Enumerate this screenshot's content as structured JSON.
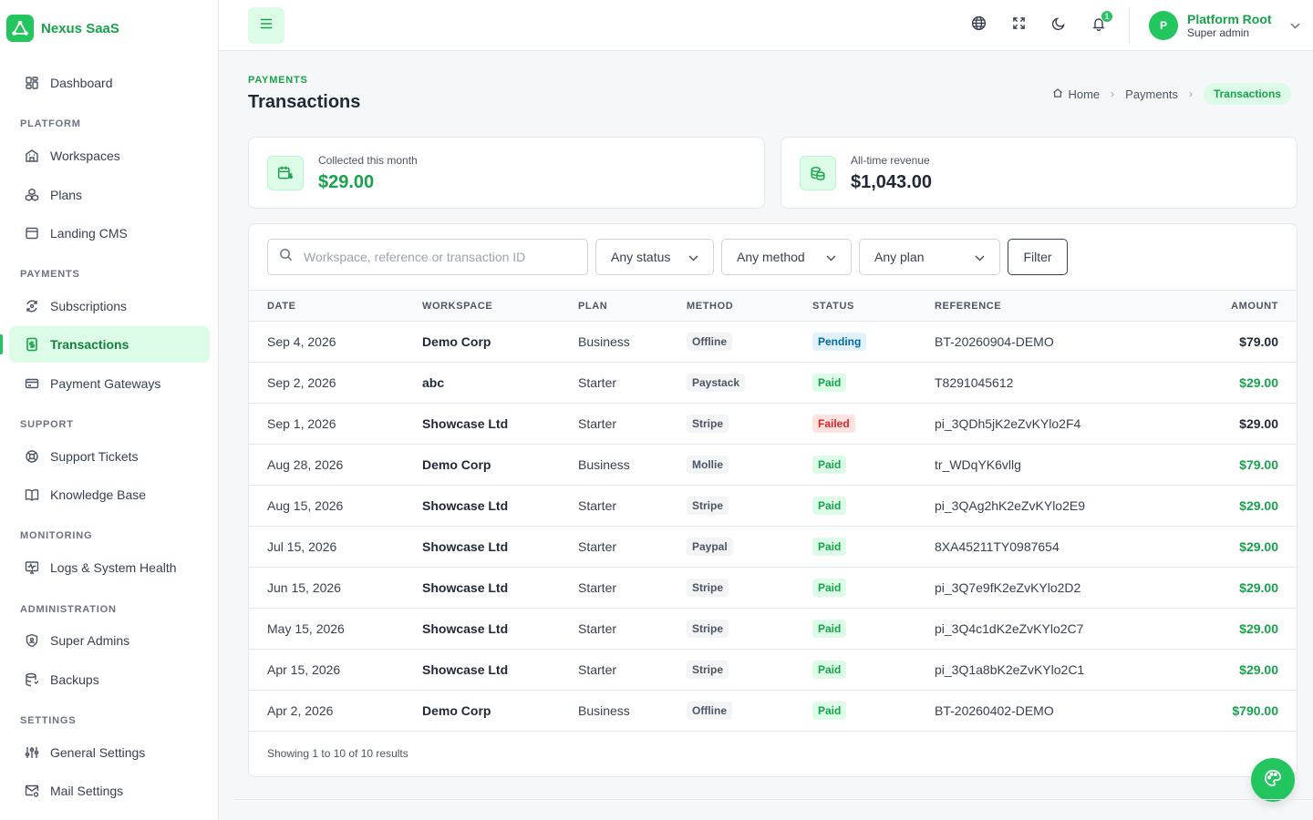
{
  "brand": {
    "name": "Nexus SaaS"
  },
  "sidebar": {
    "dashboard": "Dashboard",
    "sections": {
      "platform": "PLATFORM",
      "payments": "PAYMENTS",
      "support": "SUPPORT",
      "monitoring": "MONITORING",
      "administration": "ADMINISTRATION",
      "settings": "SETTINGS"
    },
    "items": {
      "workspaces": "Workspaces",
      "plans": "Plans",
      "landing_cms": "Landing CMS",
      "subscriptions": "Subscriptions",
      "transactions": "Transactions",
      "payment_gateways": "Payment Gateways",
      "support_tickets": "Support Tickets",
      "knowledge_base": "Knowledge Base",
      "logs": "Logs & System Health",
      "super_admins": "Super Admins",
      "backups": "Backups",
      "general_settings": "General Settings",
      "mail_settings": "Mail Settings"
    },
    "active": "transactions"
  },
  "topbar": {
    "notifications_count": "1",
    "user": {
      "initial": "P",
      "name": "Platform Root",
      "role": "Super admin"
    }
  },
  "page": {
    "kicker": "PAYMENTS",
    "title": "Transactions",
    "breadcrumb": {
      "home": "Home",
      "section": "Payments",
      "current": "Transactions"
    }
  },
  "stats": {
    "collected": {
      "label": "Collected this month",
      "value": "$29.00",
      "color": "#16a34a"
    },
    "revenue": {
      "label": "All-time revenue",
      "value": "$1,043.00",
      "color": "#1f2937"
    }
  },
  "filters": {
    "search_placeholder": "Workspace, reference or transaction ID",
    "status": "Any status",
    "method": "Any method",
    "plan": "Any plan",
    "filter_button": "Filter"
  },
  "table": {
    "headers": {
      "date": "DATE",
      "workspace": "WORKSPACE",
      "plan": "PLAN",
      "method": "METHOD",
      "status": "STATUS",
      "reference": "REFERENCE",
      "amount": "AMOUNT"
    },
    "rows": [
      {
        "date": "Sep 4, 2026",
        "workspace": "Demo Corp",
        "plan": "Business",
        "method": "Offline",
        "status": "Pending",
        "status_kind": "pending",
        "reference": "BT-20260904-DEMO",
        "amount": "$79.00"
      },
      {
        "date": "Sep 2, 2026",
        "workspace": "abc",
        "plan": "Starter",
        "method": "Paystack",
        "status": "Paid",
        "status_kind": "paid",
        "reference": "T8291045612",
        "amount": "$29.00"
      },
      {
        "date": "Sep 1, 2026",
        "workspace": "Showcase Ltd",
        "plan": "Starter",
        "method": "Stripe",
        "status": "Failed",
        "status_kind": "failed",
        "reference": "pi_3QDh5jK2eZvKYlo2F4",
        "amount": "$29.00"
      },
      {
        "date": "Aug 28, 2026",
        "workspace": "Demo Corp",
        "plan": "Business",
        "method": "Mollie",
        "status": "Paid",
        "status_kind": "paid",
        "reference": "tr_WDqYK6vllg",
        "amount": "$79.00"
      },
      {
        "date": "Aug 15, 2026",
        "workspace": "Showcase Ltd",
        "plan": "Starter",
        "method": "Stripe",
        "status": "Paid",
        "status_kind": "paid",
        "reference": "pi_3QAg2hK2eZvKYlo2E9",
        "amount": "$29.00"
      },
      {
        "date": "Jul 15, 2026",
        "workspace": "Showcase Ltd",
        "plan": "Starter",
        "method": "Paypal",
        "status": "Paid",
        "status_kind": "paid",
        "reference": "8XA45211TY0987654",
        "amount": "$29.00"
      },
      {
        "date": "Jun 15, 2026",
        "workspace": "Showcase Ltd",
        "plan": "Starter",
        "method": "Stripe",
        "status": "Paid",
        "status_kind": "paid",
        "reference": "pi_3Q7e9fK2eZvKYlo2D2",
        "amount": "$29.00"
      },
      {
        "date": "May 15, 2026",
        "workspace": "Showcase Ltd",
        "plan": "Starter",
        "method": "Stripe",
        "status": "Paid",
        "status_kind": "paid",
        "reference": "pi_3Q4c1dK2eZvKYlo2C7",
        "amount": "$29.00"
      },
      {
        "date": "Apr 15, 2026",
        "workspace": "Showcase Ltd",
        "plan": "Starter",
        "method": "Stripe",
        "status": "Paid",
        "status_kind": "paid",
        "reference": "pi_3Q1a8bK2eZvKYlo2C1",
        "amount": "$29.00"
      },
      {
        "date": "Apr 2, 2026",
        "workspace": "Demo Corp",
        "plan": "Business",
        "method": "Offline",
        "status": "Paid",
        "status_kind": "paid",
        "reference": "BT-20260402-DEMO",
        "amount": "$790.00"
      }
    ],
    "showing": "Showing 1 to 10 of 10 results"
  },
  "colors": {
    "accent": "#22c55e",
    "accent_dark": "#16a34a",
    "accent_soft": "#dcfce7"
  }
}
